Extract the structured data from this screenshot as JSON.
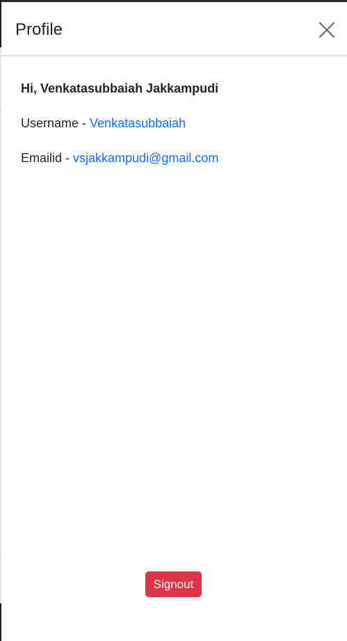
{
  "panel": {
    "title": "Profile"
  },
  "profile": {
    "greeting": "Hi, Venkatasubbaiah Jakkampudi",
    "username_label": "Username - ",
    "username_value": "Venkatasubbaiah",
    "email_label": "Emailid - ",
    "email_value": "vsjakkampudi@gmail.com"
  },
  "actions": {
    "signout_label": "Signout"
  },
  "icons": {
    "close": "close-icon"
  },
  "colors": {
    "link": "#0d6efd",
    "danger": "#dc3545",
    "text": "#212529",
    "divider": "#dee2e6"
  }
}
